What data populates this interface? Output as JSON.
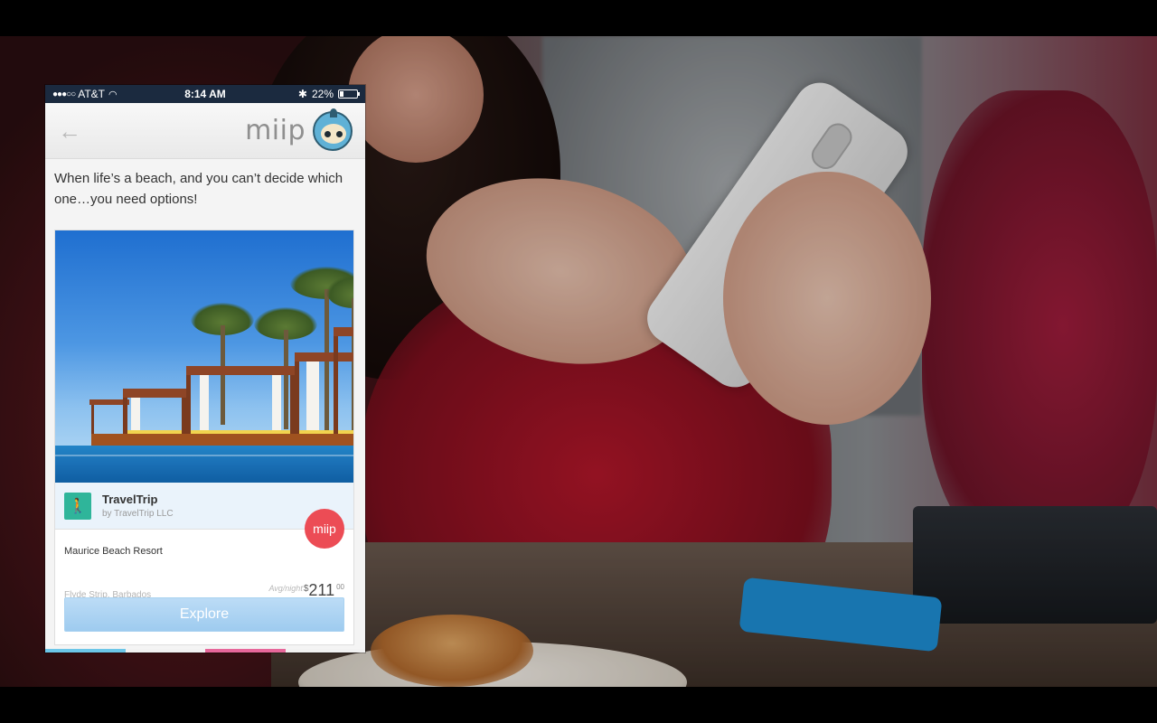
{
  "status_bar": {
    "signal": "●●●○○",
    "carrier": "AT&T",
    "time": "8:14 AM",
    "battery": "22%",
    "battery_level": 0.22
  },
  "nav": {
    "brand": "miip"
  },
  "intro": "When life’s a beach, and you can’t decide which one…you need options!",
  "card": {
    "app_name": "TravelTrip",
    "publisher": "by TravelTrip  LLC",
    "badge": "miip",
    "resort_name": "Maurice Beach Resort",
    "location": "Flyde Strip, Barbados",
    "price_label": "Avg/night",
    "price_currency": "$",
    "price_value": "211",
    "price_cents": "00",
    "cta": "Explore"
  },
  "colors": {
    "status_bar": "#1b2a3f",
    "badge": "#ec4c55",
    "cta": "#9ecbef",
    "app_icon": "#2fb59a"
  },
  "bottom_strip_colors": [
    "#6cc6e8",
    "#f2f2f2",
    "#e7679a",
    "#f2f2f2"
  ]
}
